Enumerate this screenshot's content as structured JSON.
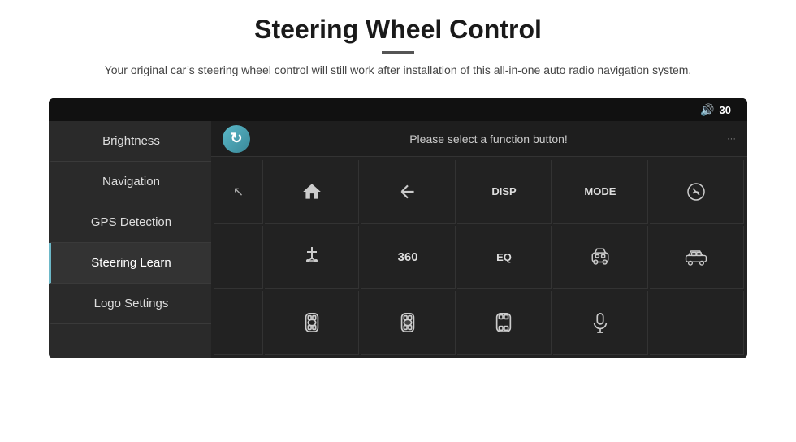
{
  "header": {
    "title": "Steering Wheel Control",
    "subtitle": "Your original car’s steering wheel control will still work after installation of this all-in-one auto radio navigation system."
  },
  "topbar": {
    "volume_label": "30"
  },
  "sidebar": {
    "items": [
      {
        "id": "brightness",
        "label": "Brightness",
        "active": false
      },
      {
        "id": "navigation",
        "label": "Navigation",
        "active": false
      },
      {
        "id": "gps-detection",
        "label": "GPS Detection",
        "active": false
      },
      {
        "id": "steering-learn",
        "label": "Steering Learn",
        "active": true
      },
      {
        "id": "logo-settings",
        "label": "Logo Settings",
        "active": false
      }
    ]
  },
  "function_bar": {
    "prompt": "Please select a function button!"
  },
  "grid": {
    "row1": [
      "home",
      "back",
      "DISP",
      "MODE",
      "phone-slash"
    ],
    "row2": [
      "antenna",
      "360",
      "EQ",
      "car-front",
      "car-side"
    ],
    "row3": [
      "car-top",
      "car-top2",
      "car-top3",
      "mic",
      ""
    ]
  }
}
